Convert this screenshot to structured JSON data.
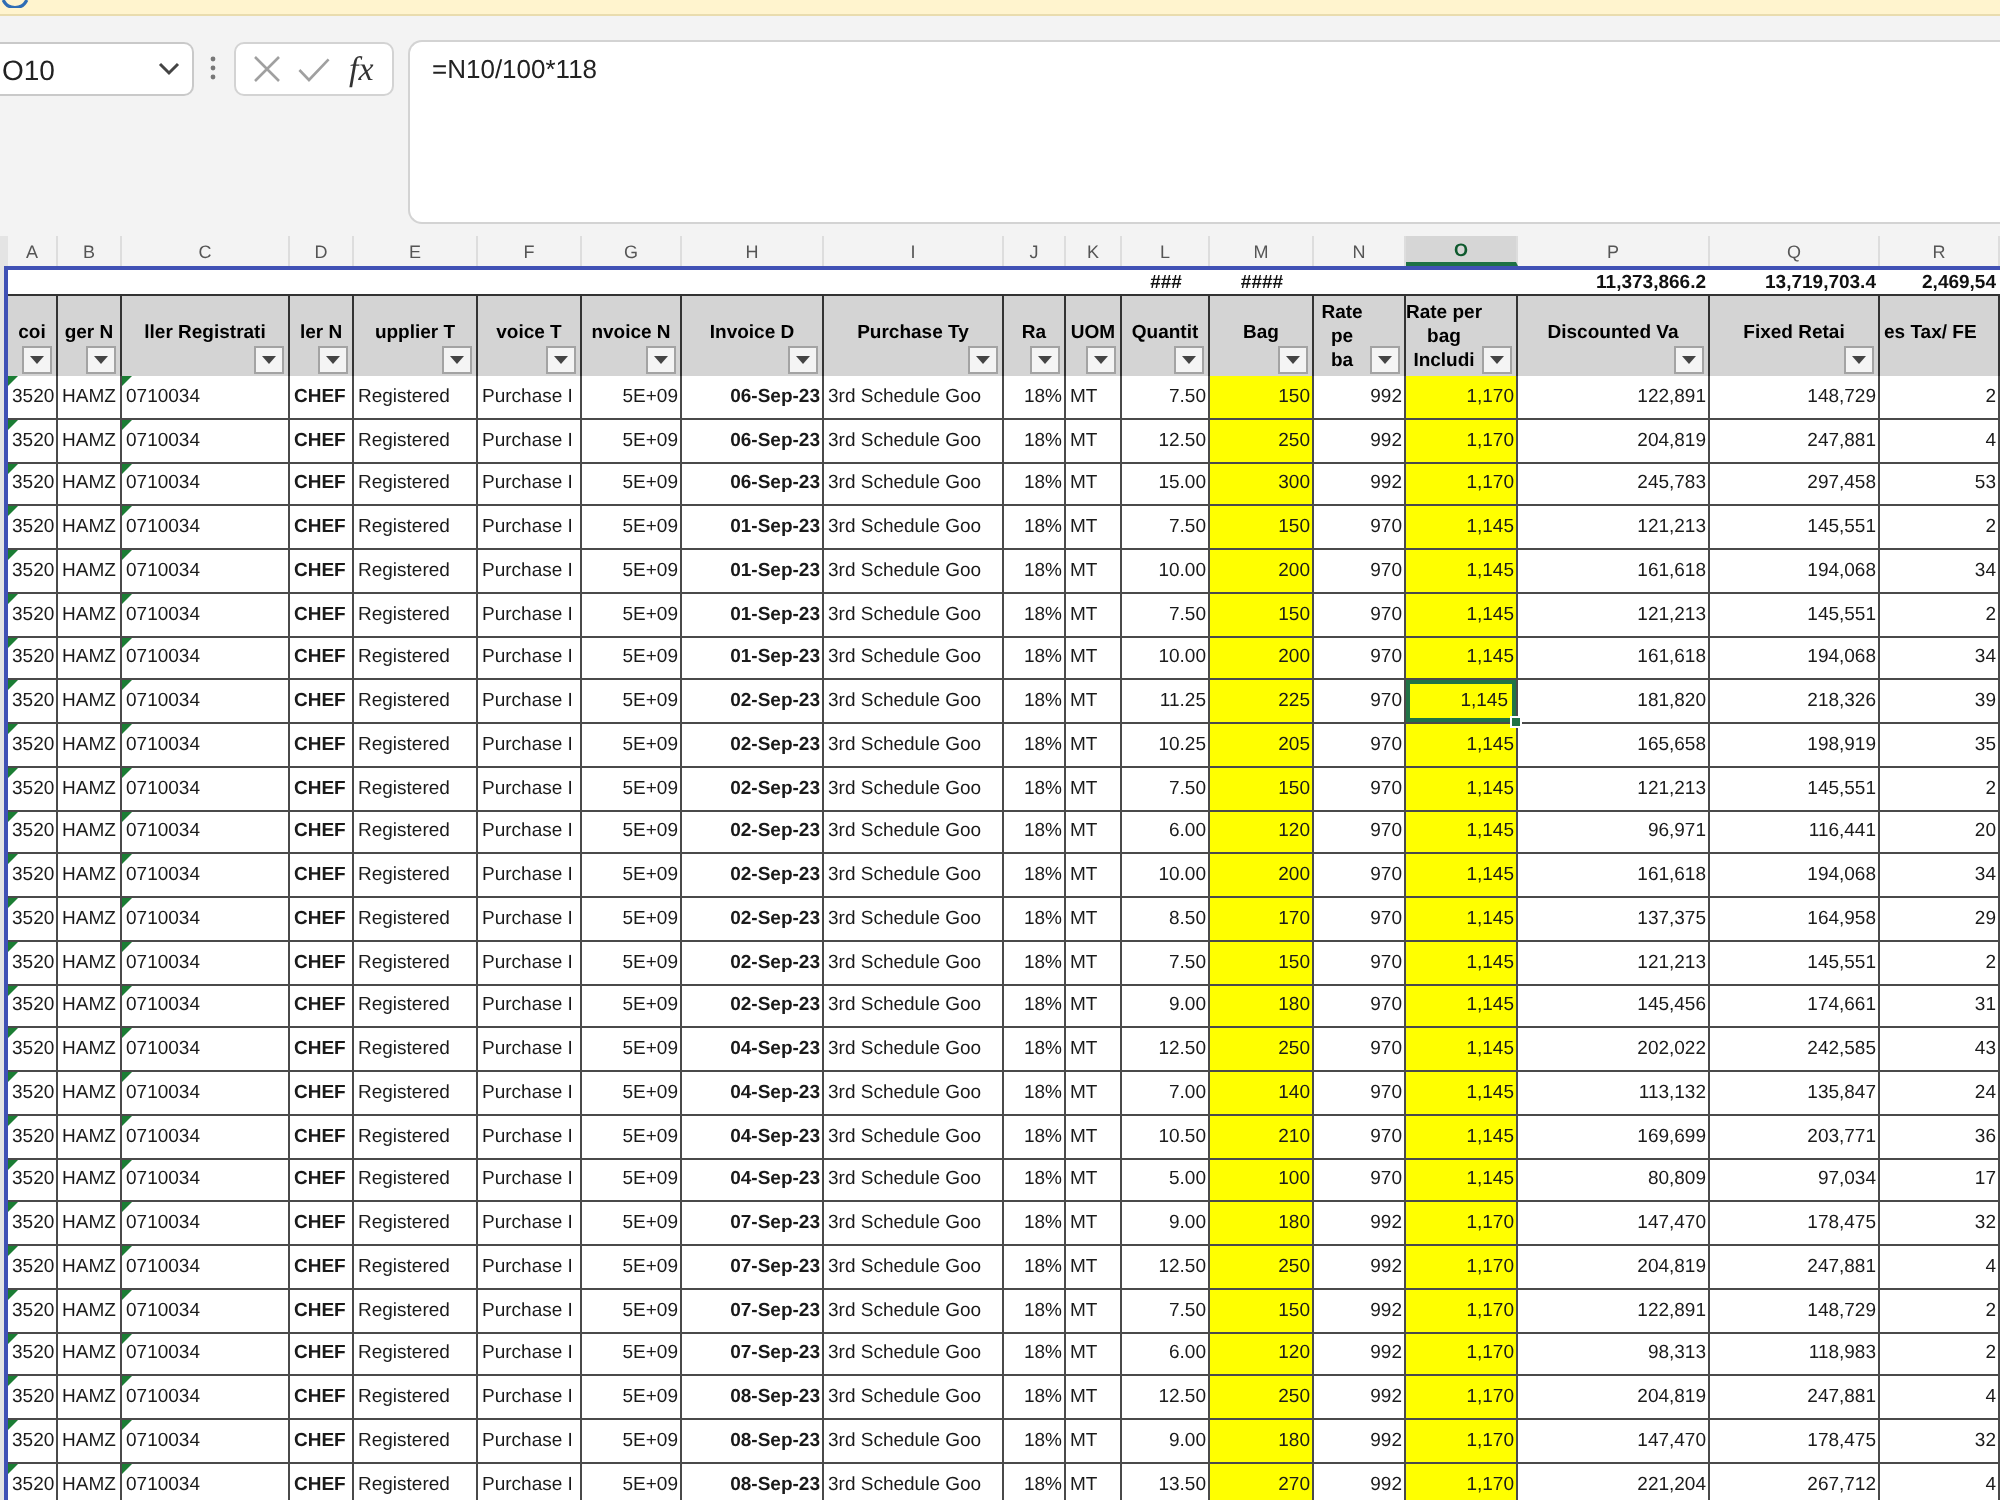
{
  "name_box": {
    "value": "O10"
  },
  "formula_bar": {
    "function_button": "fx",
    "value": "=N10/100*118"
  },
  "sheet": {
    "columns": [
      {
        "letter": "A",
        "selected": false,
        "header": "coi",
        "filter_button": true,
        "flagged": true,
        "highlighted": false
      },
      {
        "letter": "B",
        "selected": false,
        "header": "ger N",
        "filter_button": true,
        "flagged": false,
        "highlighted": false
      },
      {
        "letter": "C",
        "selected": false,
        "header": "ller Registrati",
        "filter_button": true,
        "flagged": true,
        "highlighted": false
      },
      {
        "letter": "D",
        "selected": false,
        "header": "ler N",
        "filter_button": true,
        "flagged": false,
        "highlighted": false
      },
      {
        "letter": "E",
        "selected": false,
        "header": "upplier T",
        "filter_button": true,
        "flagged": false,
        "highlighted": false
      },
      {
        "letter": "F",
        "selected": false,
        "header": "voice T",
        "filter_button": true,
        "flagged": false,
        "highlighted": false
      },
      {
        "letter": "G",
        "selected": false,
        "header": "nvoice N",
        "filter_button": true,
        "flagged": false,
        "highlighted": false
      },
      {
        "letter": "H",
        "selected": false,
        "header": "Invoice D",
        "filter_button": true,
        "flagged": false,
        "highlighted": false
      },
      {
        "letter": "I",
        "selected": false,
        "header": "Purchase Ty",
        "filter_button": true,
        "flagged": false,
        "highlighted": false
      },
      {
        "letter": "J",
        "selected": false,
        "header": "Ra",
        "filter_button": true,
        "flagged": false,
        "highlighted": false
      },
      {
        "letter": "K",
        "selected": false,
        "header": "UOM",
        "filter_button": true,
        "flagged": false,
        "highlighted": false
      },
      {
        "letter": "L",
        "selected": false,
        "header": "Quantit",
        "filter_button": true,
        "flagged": false,
        "highlighted": false,
        "total": "###"
      },
      {
        "letter": "M",
        "selected": false,
        "header": "Bag",
        "filter_button": true,
        "flagged": false,
        "highlighted": true,
        "total": "####"
      },
      {
        "letter": "N",
        "selected": false,
        "header": "Rate\npe\nba",
        "filter_button": true,
        "flagged": false,
        "highlighted": false
      },
      {
        "letter": "O",
        "selected": true,
        "header": "Rate per\nbag\nIncludi",
        "filter_button": true,
        "flagged": false,
        "highlighted": true
      },
      {
        "letter": "P",
        "selected": false,
        "header": "Discounted Va",
        "filter_button": true,
        "flagged": false,
        "highlighted": false,
        "total": "11,373,866.2"
      },
      {
        "letter": "Q",
        "selected": false,
        "header": "Fixed Retai",
        "filter_button": true,
        "flagged": false,
        "highlighted": false,
        "total": "13,719,703.4"
      },
      {
        "letter": "R",
        "selected": false,
        "header": "es Tax/ FE",
        "filter_button": false,
        "flagged": false,
        "highlighted": false,
        "total": "2,469,54"
      }
    ],
    "rows": [
      {
        "selected": false,
        "cells": [
          "3520",
          "HAMZ",
          "0710034",
          "CHEF",
          "Registered",
          "Purchase I",
          "5E+09",
          "06-Sep-23",
          "3rd Schedule Goo",
          "18%",
          "MT",
          "7.50",
          "150",
          "992",
          "1,170",
          "122,891",
          "148,729",
          "2"
        ]
      },
      {
        "selected": false,
        "cells": [
          "3520",
          "HAMZ",
          "0710034",
          "CHEF",
          "Registered",
          "Purchase I",
          "5E+09",
          "06-Sep-23",
          "3rd Schedule Goo",
          "18%",
          "MT",
          "12.50",
          "250",
          "992",
          "1,170",
          "204,819",
          "247,881",
          "4"
        ]
      },
      {
        "selected": false,
        "cells": [
          "3520",
          "HAMZ",
          "0710034",
          "CHEF",
          "Registered",
          "Purchase I",
          "5E+09",
          "06-Sep-23",
          "3rd Schedule Goo",
          "18%",
          "MT",
          "15.00",
          "300",
          "992",
          "1,170",
          "245,783",
          "297,458",
          "53"
        ]
      },
      {
        "selected": false,
        "cells": [
          "3520",
          "HAMZ",
          "0710034",
          "CHEF",
          "Registered",
          "Purchase I",
          "5E+09",
          "01-Sep-23",
          "3rd Schedule Goo",
          "18%",
          "MT",
          "7.50",
          "150",
          "970",
          "1,145",
          "121,213",
          "145,551",
          "2"
        ]
      },
      {
        "selected": false,
        "cells": [
          "3520",
          "HAMZ",
          "0710034",
          "CHEF",
          "Registered",
          "Purchase I",
          "5E+09",
          "01-Sep-23",
          "3rd Schedule Goo",
          "18%",
          "MT",
          "10.00",
          "200",
          "970",
          "1,145",
          "161,618",
          "194,068",
          "34"
        ]
      },
      {
        "selected": false,
        "cells": [
          "3520",
          "HAMZ",
          "0710034",
          "CHEF",
          "Registered",
          "Purchase I",
          "5E+09",
          "01-Sep-23",
          "3rd Schedule Goo",
          "18%",
          "MT",
          "7.50",
          "150",
          "970",
          "1,145",
          "121,213",
          "145,551",
          "2"
        ]
      },
      {
        "selected": false,
        "cells": [
          "3520",
          "HAMZ",
          "0710034",
          "CHEF",
          "Registered",
          "Purchase I",
          "5E+09",
          "01-Sep-23",
          "3rd Schedule Goo",
          "18%",
          "MT",
          "10.00",
          "200",
          "970",
          "1,145",
          "161,618",
          "194,068",
          "34"
        ]
      },
      {
        "selected": true,
        "cells": [
          "3520",
          "HAMZ",
          "0710034",
          "CHEF",
          "Registered",
          "Purchase I",
          "5E+09",
          "02-Sep-23",
          "3rd Schedule Goo",
          "18%",
          "MT",
          "11.25",
          "225",
          "970",
          "1,145",
          "181,820",
          "218,326",
          "39"
        ]
      },
      {
        "selected": false,
        "cells": [
          "3520",
          "HAMZ",
          "0710034",
          "CHEF",
          "Registered",
          "Purchase I",
          "5E+09",
          "02-Sep-23",
          "3rd Schedule Goo",
          "18%",
          "MT",
          "10.25",
          "205",
          "970",
          "1,145",
          "165,658",
          "198,919",
          "35"
        ]
      },
      {
        "selected": false,
        "cells": [
          "3520",
          "HAMZ",
          "0710034",
          "CHEF",
          "Registered",
          "Purchase I",
          "5E+09",
          "02-Sep-23",
          "3rd Schedule Goo",
          "18%",
          "MT",
          "7.50",
          "150",
          "970",
          "1,145",
          "121,213",
          "145,551",
          "2"
        ]
      },
      {
        "selected": false,
        "cells": [
          "3520",
          "HAMZ",
          "0710034",
          "CHEF",
          "Registered",
          "Purchase I",
          "5E+09",
          "02-Sep-23",
          "3rd Schedule Goo",
          "18%",
          "MT",
          "6.00",
          "120",
          "970",
          "1,145",
          "96,971",
          "116,441",
          "20"
        ]
      },
      {
        "selected": false,
        "cells": [
          "3520",
          "HAMZ",
          "0710034",
          "CHEF",
          "Registered",
          "Purchase I",
          "5E+09",
          "02-Sep-23",
          "3rd Schedule Goo",
          "18%",
          "MT",
          "10.00",
          "200",
          "970",
          "1,145",
          "161,618",
          "194,068",
          "34"
        ]
      },
      {
        "selected": false,
        "cells": [
          "3520",
          "HAMZ",
          "0710034",
          "CHEF",
          "Registered",
          "Purchase I",
          "5E+09",
          "02-Sep-23",
          "3rd Schedule Goo",
          "18%",
          "MT",
          "8.50",
          "170",
          "970",
          "1,145",
          "137,375",
          "164,958",
          "29"
        ]
      },
      {
        "selected": false,
        "cells": [
          "3520",
          "HAMZ",
          "0710034",
          "CHEF",
          "Registered",
          "Purchase I",
          "5E+09",
          "02-Sep-23",
          "3rd Schedule Goo",
          "18%",
          "MT",
          "7.50",
          "150",
          "970",
          "1,145",
          "121,213",
          "145,551",
          "2"
        ]
      },
      {
        "selected": false,
        "cells": [
          "3520",
          "HAMZ",
          "0710034",
          "CHEF",
          "Registered",
          "Purchase I",
          "5E+09",
          "02-Sep-23",
          "3rd Schedule Goo",
          "18%",
          "MT",
          "9.00",
          "180",
          "970",
          "1,145",
          "145,456",
          "174,661",
          "31"
        ]
      },
      {
        "selected": false,
        "cells": [
          "3520",
          "HAMZ",
          "0710034",
          "CHEF",
          "Registered",
          "Purchase I",
          "5E+09",
          "04-Sep-23",
          "3rd Schedule Goo",
          "18%",
          "MT",
          "12.50",
          "250",
          "970",
          "1,145",
          "202,022",
          "242,585",
          "43"
        ]
      },
      {
        "selected": false,
        "cells": [
          "3520",
          "HAMZ",
          "0710034",
          "CHEF",
          "Registered",
          "Purchase I",
          "5E+09",
          "04-Sep-23",
          "3rd Schedule Goo",
          "18%",
          "MT",
          "7.00",
          "140",
          "970",
          "1,145",
          "113,132",
          "135,847",
          "24"
        ]
      },
      {
        "selected": false,
        "cells": [
          "3520",
          "HAMZ",
          "0710034",
          "CHEF",
          "Registered",
          "Purchase I",
          "5E+09",
          "04-Sep-23",
          "3rd Schedule Goo",
          "18%",
          "MT",
          "10.50",
          "210",
          "970",
          "1,145",
          "169,699",
          "203,771",
          "36"
        ]
      },
      {
        "selected": false,
        "cells": [
          "3520",
          "HAMZ",
          "0710034",
          "CHEF",
          "Registered",
          "Purchase I",
          "5E+09",
          "04-Sep-23",
          "3rd Schedule Goo",
          "18%",
          "MT",
          "5.00",
          "100",
          "970",
          "1,145",
          "80,809",
          "97,034",
          "17"
        ]
      },
      {
        "selected": false,
        "cells": [
          "3520",
          "HAMZ",
          "0710034",
          "CHEF",
          "Registered",
          "Purchase I",
          "5E+09",
          "07-Sep-23",
          "3rd Schedule Goo",
          "18%",
          "MT",
          "9.00",
          "180",
          "992",
          "1,170",
          "147,470",
          "178,475",
          "32"
        ]
      },
      {
        "selected": false,
        "cells": [
          "3520",
          "HAMZ",
          "0710034",
          "CHEF",
          "Registered",
          "Purchase I",
          "5E+09",
          "07-Sep-23",
          "3rd Schedule Goo",
          "18%",
          "MT",
          "12.50",
          "250",
          "992",
          "1,170",
          "204,819",
          "247,881",
          "4"
        ]
      },
      {
        "selected": false,
        "cells": [
          "3520",
          "HAMZ",
          "0710034",
          "CHEF",
          "Registered",
          "Purchase I",
          "5E+09",
          "07-Sep-23",
          "3rd Schedule Goo",
          "18%",
          "MT",
          "7.50",
          "150",
          "992",
          "1,170",
          "122,891",
          "148,729",
          "2"
        ]
      },
      {
        "selected": false,
        "cells": [
          "3520",
          "HAMZ",
          "0710034",
          "CHEF",
          "Registered",
          "Purchase I",
          "5E+09",
          "07-Sep-23",
          "3rd Schedule Goo",
          "18%",
          "MT",
          "6.00",
          "120",
          "992",
          "1,170",
          "98,313",
          "118,983",
          "2"
        ]
      },
      {
        "selected": false,
        "cells": [
          "3520",
          "HAMZ",
          "0710034",
          "CHEF",
          "Registered",
          "Purchase I",
          "5E+09",
          "08-Sep-23",
          "3rd Schedule Goo",
          "18%",
          "MT",
          "12.50",
          "250",
          "992",
          "1,170",
          "204,819",
          "247,881",
          "4"
        ]
      },
      {
        "selected": false,
        "cells": [
          "3520",
          "HAMZ",
          "0710034",
          "CHEF",
          "Registered",
          "Purchase I",
          "5E+09",
          "08-Sep-23",
          "3rd Schedule Goo",
          "18%",
          "MT",
          "9.00",
          "180",
          "992",
          "1,170",
          "147,470",
          "178,475",
          "32"
        ]
      },
      {
        "selected": false,
        "cells": [
          "3520",
          "HAMZ",
          "0710034",
          "CHEF",
          "Registered",
          "Purchase I",
          "5E+09",
          "08-Sep-23",
          "3rd Schedule Goo",
          "18%",
          "MT",
          "13.50",
          "270",
          "992",
          "1,170",
          "221,204",
          "267,712",
          "4"
        ]
      }
    ]
  }
}
